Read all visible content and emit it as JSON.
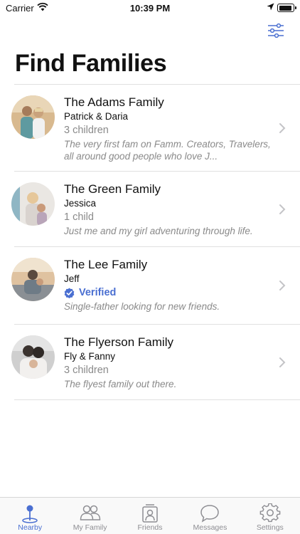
{
  "status_bar": {
    "carrier": "Carrier",
    "time": "10:39 PM"
  },
  "header": {
    "title": "Find Families",
    "filter_icon": "sliders-icon"
  },
  "families": [
    {
      "name": "The Adams Family",
      "parents": "Patrick & Daria",
      "children": "3 children",
      "description": "The very first fam on Famm. Creators, Travelers, all around good people who love J..."
    },
    {
      "name": "The Green Family",
      "parents": "Jessica",
      "children": "1 child",
      "description": "Just me and my girl adventuring through life."
    },
    {
      "name": "The Lee Family",
      "parents": "Jeff",
      "verified": "Verified",
      "description": "Single-father looking for new friends."
    },
    {
      "name": "The Flyerson Family",
      "parents": "Fly & Fanny",
      "children": "3 children",
      "description": "The flyest family out there."
    }
  ],
  "tabs": [
    {
      "label": "Nearby",
      "icon": "map-pin-icon",
      "active": true
    },
    {
      "label": "My Family",
      "icon": "people-icon",
      "active": false
    },
    {
      "label": "Friends",
      "icon": "contact-card-icon",
      "active": false
    },
    {
      "label": "Messages",
      "icon": "chat-bubble-icon",
      "active": false
    },
    {
      "label": "Settings",
      "icon": "gear-icon",
      "active": false
    }
  ],
  "colors": {
    "accent": "#4a6fd1",
    "secondary_text": "#8a8a8a",
    "divider": "#e0e0e0"
  }
}
